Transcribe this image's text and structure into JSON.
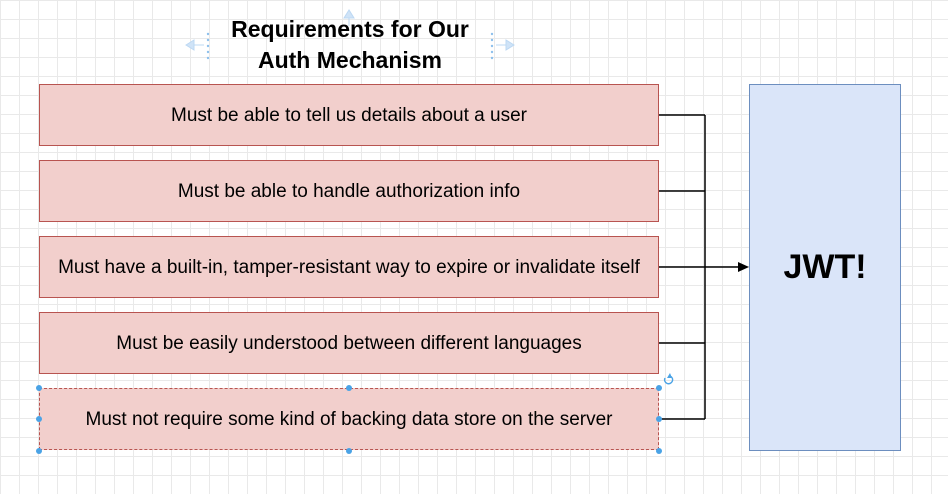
{
  "diagram": {
    "title_lines": [
      "Requirements for Our",
      "Auth Mechanism"
    ],
    "requirements": [
      "Must be able to tell us details about a user",
      "Must be able to handle authorization info",
      "Must have a built-in, tamper-resistant way to expire or invalidate itself",
      "Must be easily understood between different languages",
      "Must not require some kind of backing data store on the server"
    ],
    "result_label": "JWT!"
  },
  "colors": {
    "requirement_fill": "#f2cfcc",
    "requirement_stroke": "#b85450",
    "result_fill": "#dae5f9",
    "result_stroke": "#6c8ebf",
    "selection_handle": "#4aa3e6"
  }
}
